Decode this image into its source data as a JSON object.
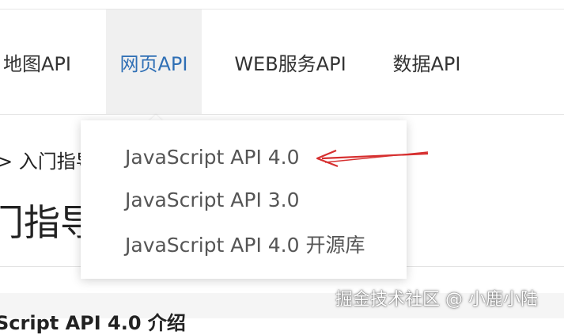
{
  "nav": {
    "items": [
      {
        "label": "地图API"
      },
      {
        "label": "网页API",
        "active": true
      },
      {
        "label": "WEB服务API"
      },
      {
        "label": "数据API"
      }
    ],
    "active_color": "#2f6fb5"
  },
  "breadcrumb": {
    "text": "> 入门指导"
  },
  "page_title": {
    "text": "门指导"
  },
  "section": {
    "heading": "Script API 4.0 介绍"
  },
  "dropdown": {
    "items": [
      {
        "label": "JavaScript API 4.0"
      },
      {
        "label": "JavaScript API 3.0"
      },
      {
        "label": "JavaScript API 4.0 开源库"
      }
    ]
  },
  "annotation": {
    "arrow_color": "#d62f2f"
  },
  "watermark": {
    "text": "掘金技术社区 @ 小鹿小陆"
  }
}
